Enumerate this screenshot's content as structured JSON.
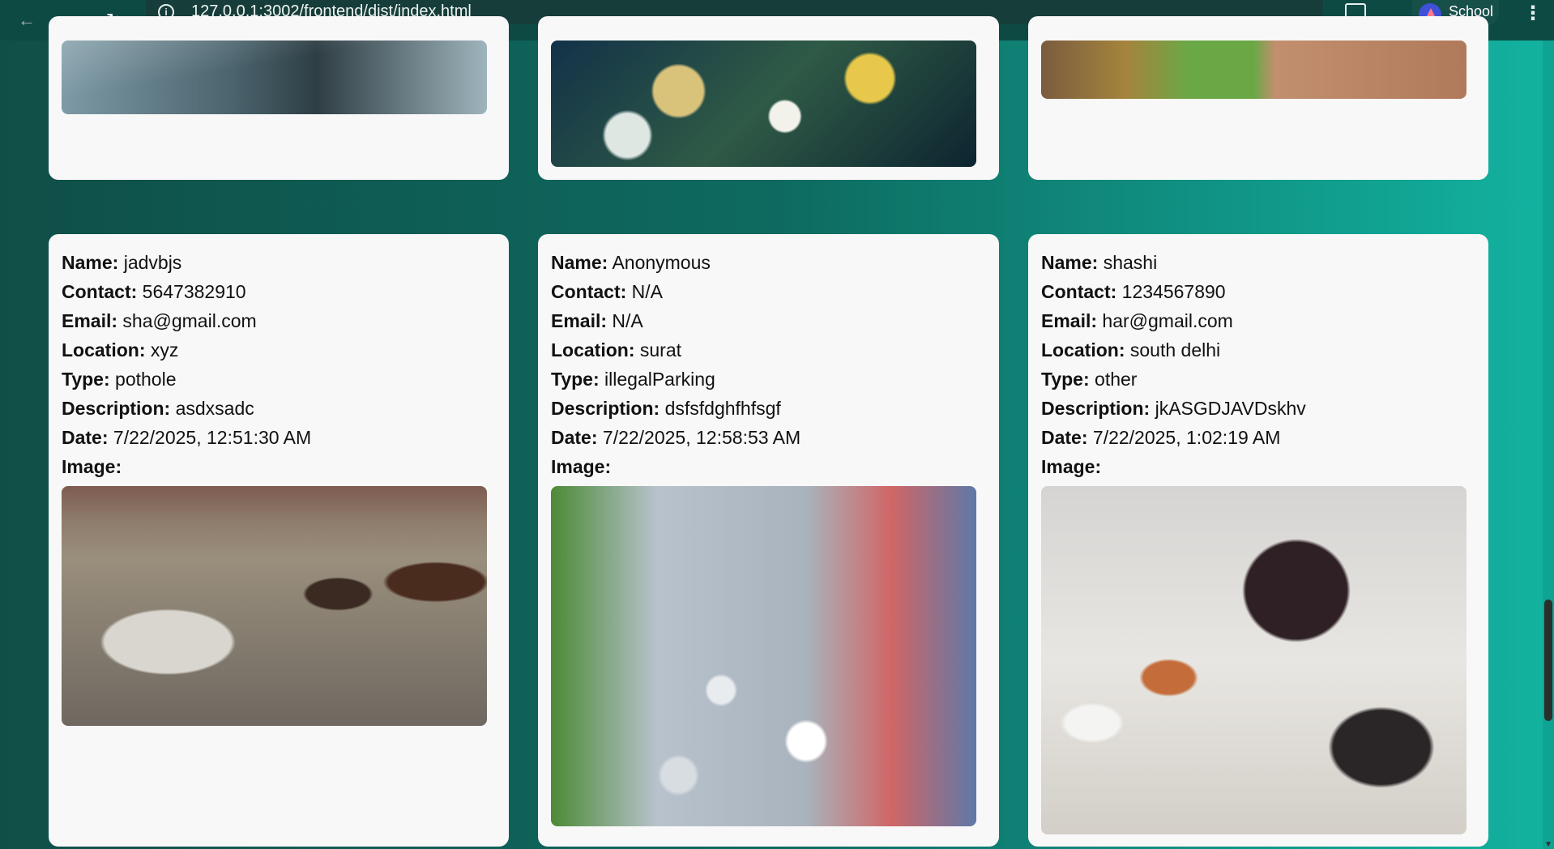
{
  "browser": {
    "url": "127.0.0.1:3002/frontend/dist/index.html",
    "profile_label": "School",
    "icons": [
      "back-arrow-icon",
      "forward-arrow-icon",
      "reload-icon",
      "info-icon",
      "star-icon",
      "extensions-icon",
      "profile-avatar-icon",
      "more-menu-icon"
    ]
  },
  "labels": {
    "name": "Name:",
    "contact": "Contact:",
    "email": "Email:",
    "location": "Location:",
    "type": "Type:",
    "description": "Description:",
    "date": "Date:",
    "image": "Image:"
  },
  "reports": [
    {
      "name": "jadvbjs",
      "contact": "5647382910",
      "email": "sha@gmail.com",
      "location": "xyz",
      "type": "pothole",
      "description": "asdxsadc",
      "date": "7/22/2025, 12:51:30 AM"
    },
    {
      "name": "Anonymous",
      "contact": "N/A",
      "email": "N/A",
      "location": "surat",
      "type": "illegalParking",
      "description": "dsfsfdghfhfsgf",
      "date": "7/22/2025, 12:58:53 AM"
    },
    {
      "name": "shashi",
      "contact": "1234567890",
      "email": "har@gmail.com",
      "location": "south delhi",
      "type": "other",
      "description": "jkASGDJAVDskhv",
      "date": "7/22/2025, 1:02:19 AM"
    }
  ]
}
